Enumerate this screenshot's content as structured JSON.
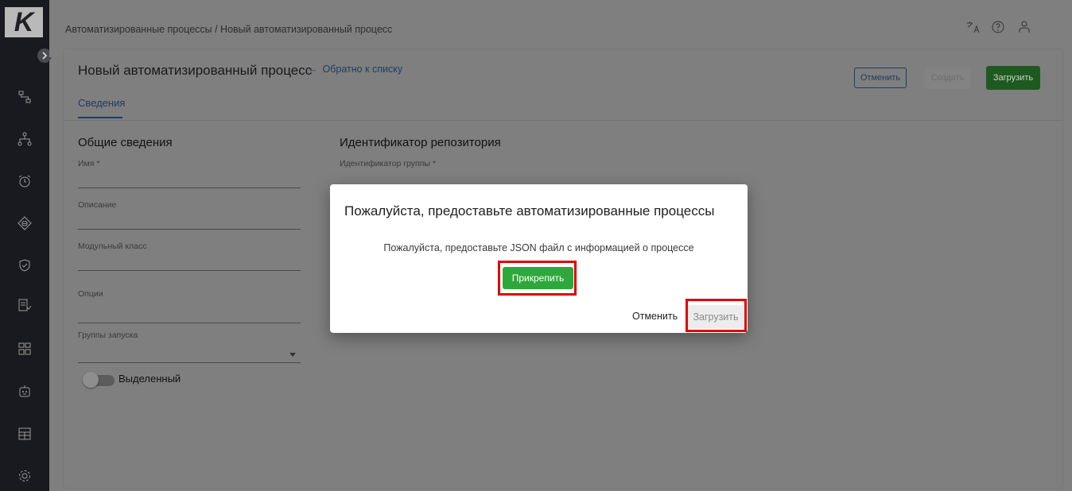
{
  "app": {
    "logo_letter": "K"
  },
  "topbar": {
    "breadcrumb": "Автоматизированные процессы / Новый автоматизированный процесс",
    "icons": [
      "translate-icon",
      "help-icon",
      "user-icon"
    ]
  },
  "sidebar": {
    "icons": [
      "process-icon",
      "hierarchy-icon",
      "alarm-icon",
      "data-icon",
      "shield-icon",
      "checklist-icon",
      "grid-icon",
      "robot-icon",
      "calendar-icon",
      "settings-icon"
    ]
  },
  "header": {
    "title": "Новый автоматизированный процесс",
    "back_link": "Обратно к списку",
    "cancel_label": "Отменить",
    "create_label": "Создать",
    "upload_label": "Загрузить"
  },
  "tabs": [
    {
      "label": "Сведения"
    }
  ],
  "form": {
    "general_title": "Общие сведения",
    "repo_title": "Идентификатор репозитория",
    "name_label": "Имя *",
    "description_label": "Описание",
    "module_class_label": "Модульный класс",
    "options_label": "Опции",
    "run_groups_label": "Группы запуска",
    "group_id_label": "Идентификатор группы *",
    "dedicated_label": "Выделенный"
  },
  "modal": {
    "title": "Пожалуйста, предоставьте автоматизированные процессы",
    "text": "Пожалуйста, предоставьте JSON файл с информацией о процессе",
    "attach_label": "Прикрепить",
    "cancel_label": "Отменить",
    "upload_label": "Загрузить"
  },
  "colors": {
    "accent_green": "#2ea83a",
    "highlight_red": "#e00000",
    "link_blue": "#1f3c63"
  }
}
